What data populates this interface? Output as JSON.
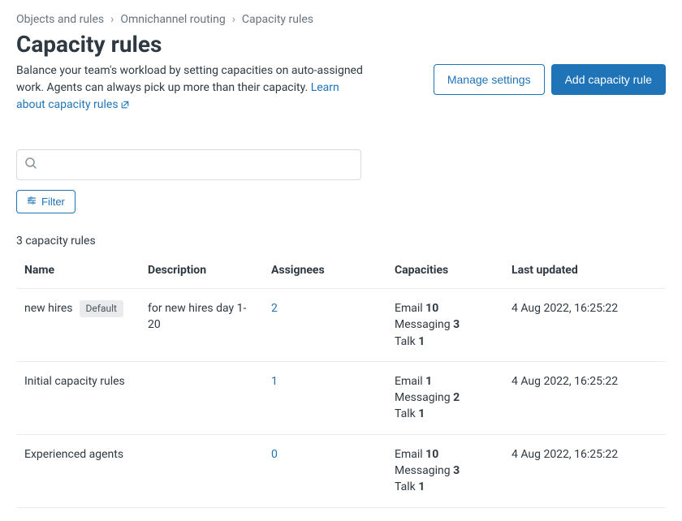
{
  "breadcrumb": {
    "items": [
      "Objects and rules",
      "Omnichannel routing",
      "Capacity rules"
    ]
  },
  "header": {
    "title": "Capacity rules",
    "subtitle_prefix": "Balance your team's workload by setting capacities on auto-assigned work. Agents can always pick up more than their capacity. ",
    "link_text": "Learn about capacity rules"
  },
  "actions": {
    "manage": "Manage settings",
    "add": "Add capacity rule"
  },
  "search": {
    "placeholder": ""
  },
  "filter": {
    "label": "Filter"
  },
  "count_label": "3 capacity rules",
  "columns": {
    "name": "Name",
    "description": "Description",
    "assignees": "Assignees",
    "capacities": "Capacities",
    "last_updated": "Last updated"
  },
  "badge_default": "Default",
  "rows": [
    {
      "name": "new hires",
      "default": true,
      "description": "for new hires day 1-20",
      "assignees": "2",
      "cap_email_label": "Email",
      "cap_email_val": "10",
      "cap_msg_label": "Messaging",
      "cap_msg_val": "3",
      "cap_talk_label": "Talk",
      "cap_talk_val": "1",
      "last_updated": "4 Aug 2022, 16:25:22"
    },
    {
      "name": "Initial capacity rules",
      "default": false,
      "description": "",
      "assignees": "1",
      "cap_email_label": "Email",
      "cap_email_val": "1",
      "cap_msg_label": "Messaging",
      "cap_msg_val": "2",
      "cap_talk_label": "Talk",
      "cap_talk_val": "1",
      "last_updated": "4 Aug 2022, 16:25:22"
    },
    {
      "name": "Experienced agents",
      "default": false,
      "description": "",
      "assignees": "0",
      "cap_email_label": "Email",
      "cap_email_val": "10",
      "cap_msg_label": "Messaging",
      "cap_msg_val": "3",
      "cap_talk_label": "Talk",
      "cap_talk_val": "1",
      "last_updated": "4 Aug 2022, 16:25:22"
    }
  ]
}
